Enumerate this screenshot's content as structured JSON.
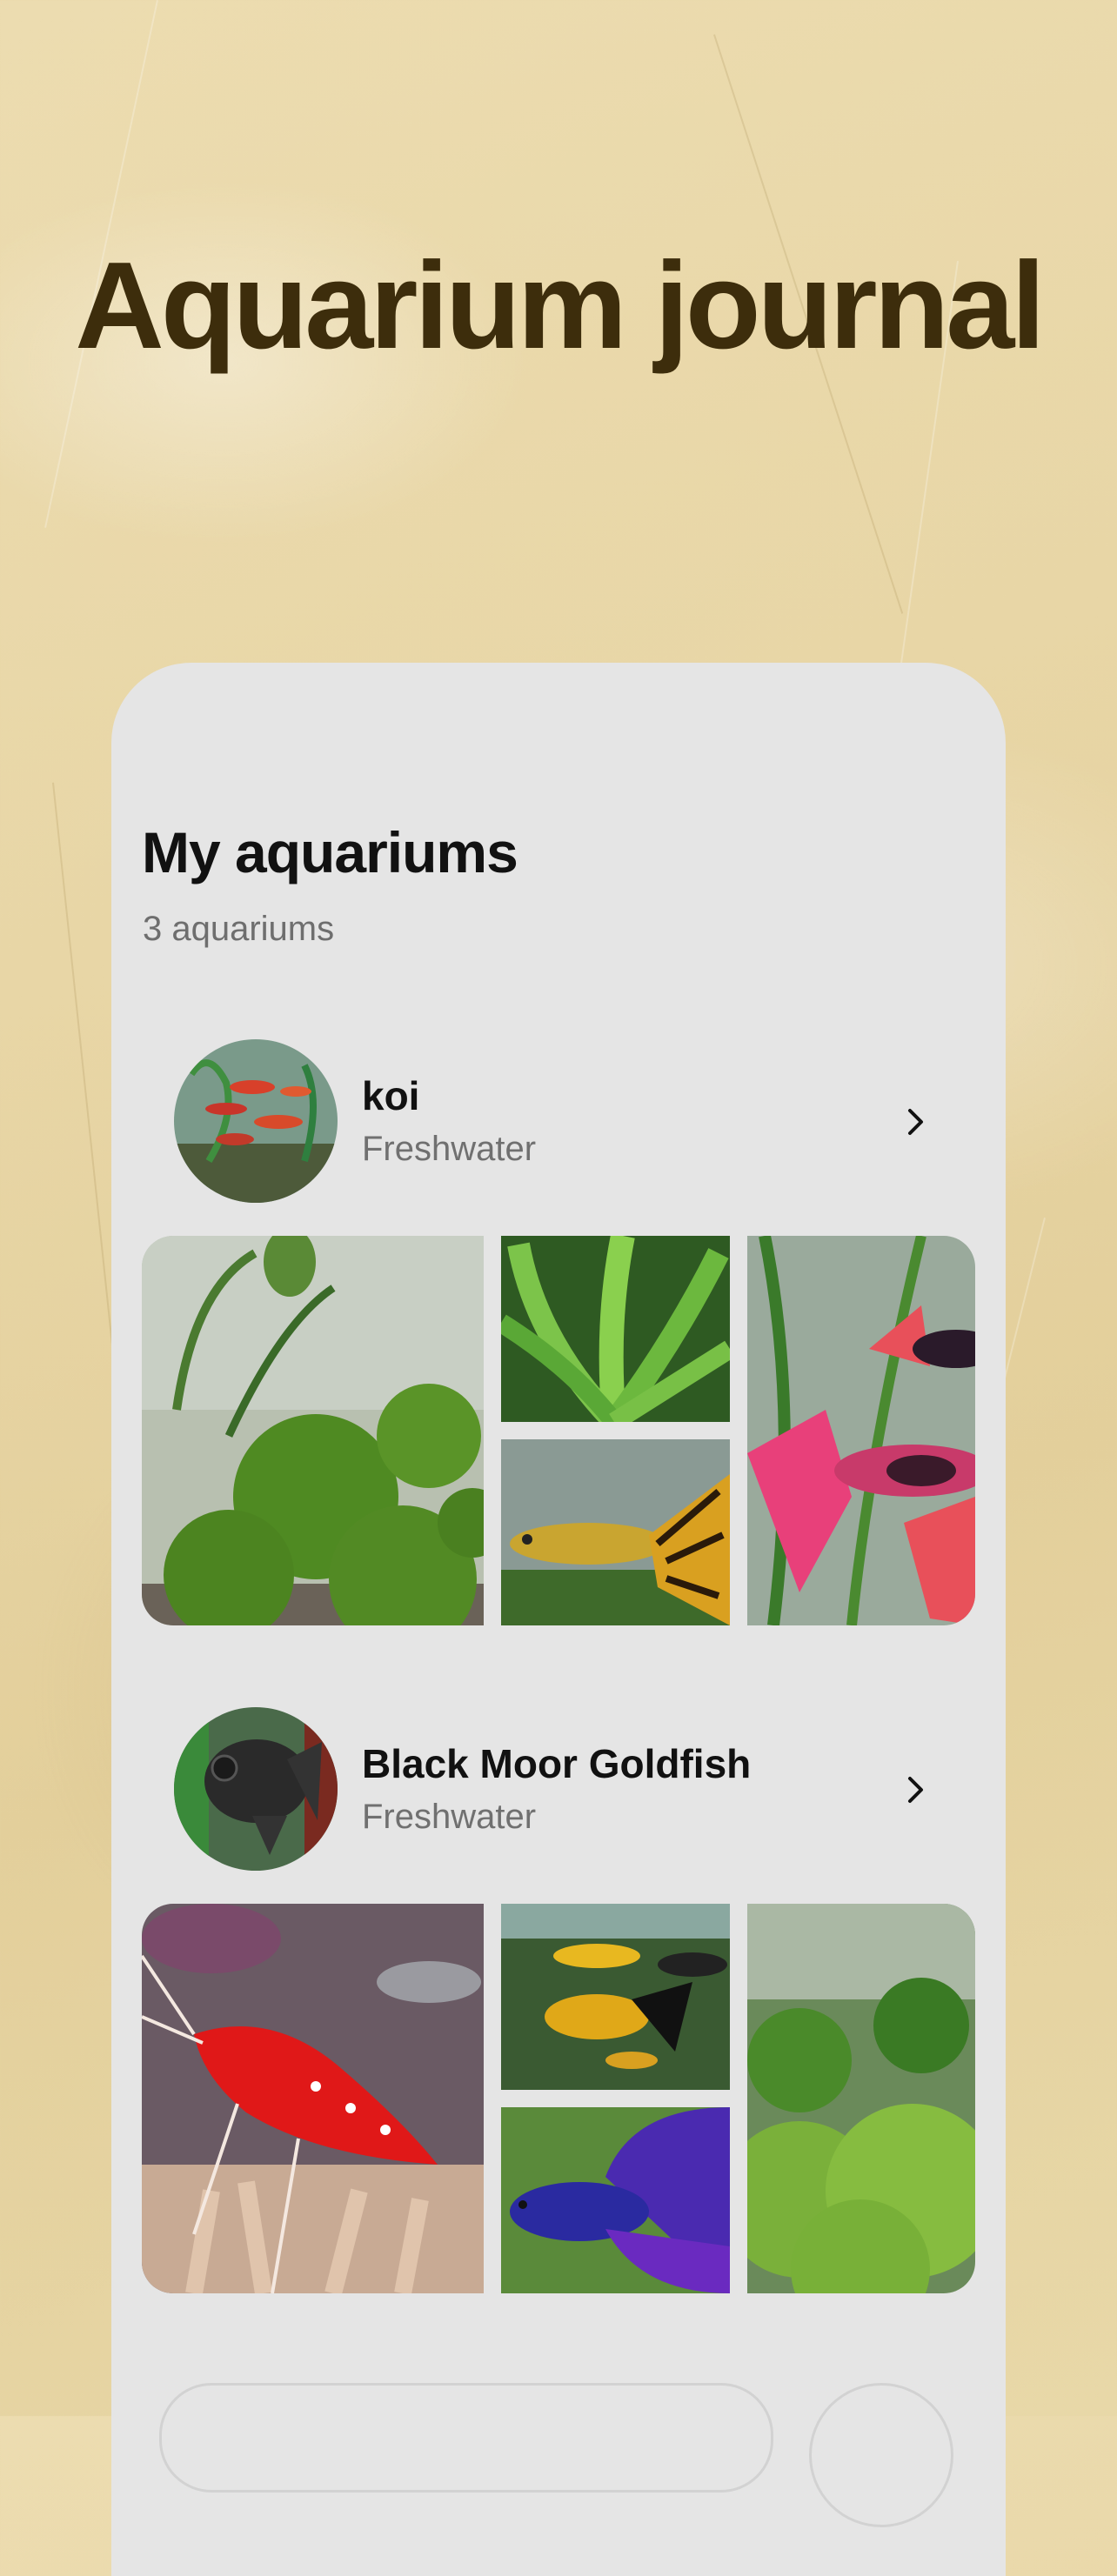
{
  "hero": {
    "title": "Aquarium journal"
  },
  "screen": {
    "title": "My aquariums",
    "subtitle": "3 aquariums"
  },
  "aquariums": [
    {
      "name": "koi",
      "type": "Freshwater",
      "avatar_icon": "red-fish-tank-photo"
    },
    {
      "name": "Black Moor Goldfish",
      "type": "Freshwater",
      "avatar_icon": "black-goldfish-photo"
    }
  ],
  "colors": {
    "hero_text": "#3d2d0c",
    "card_bg": "#e5e5e5",
    "secondary_text": "#707070"
  }
}
